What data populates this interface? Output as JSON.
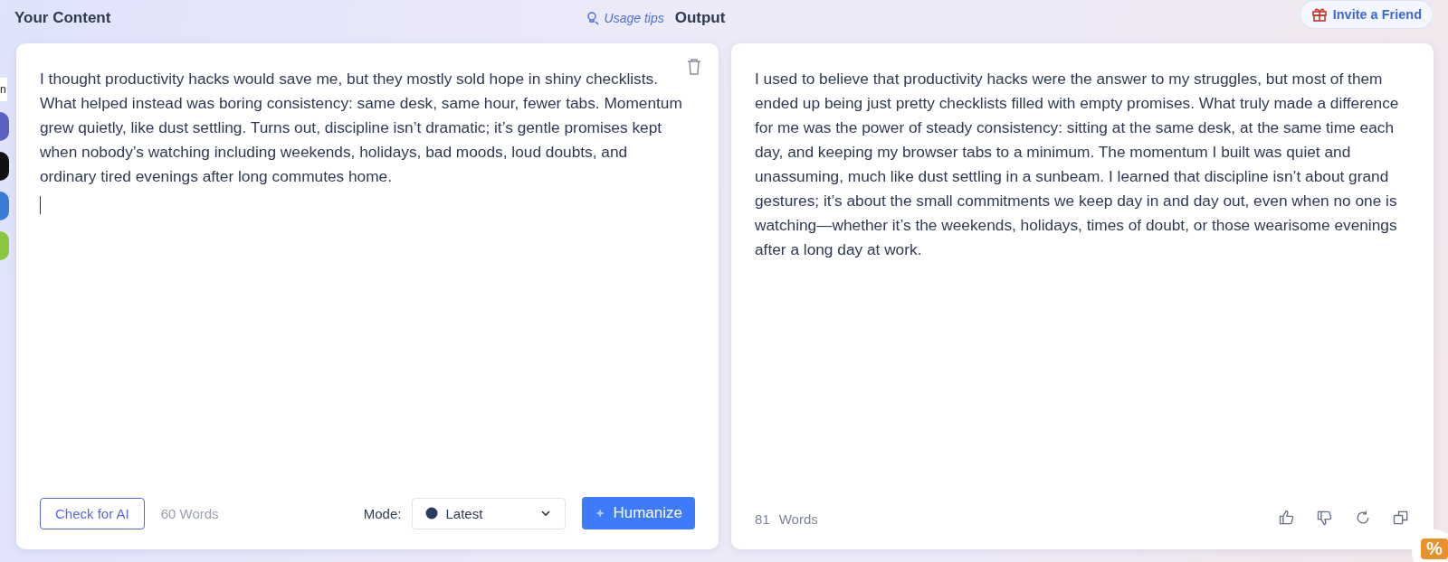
{
  "header": {
    "left_title": "Your Content",
    "usage_tips": "Usage tips",
    "right_title": "Output",
    "invite_button": "Invite a Friend"
  },
  "side_strip": {
    "partial_label": "n"
  },
  "input_panel": {
    "text": "I thought productivity hacks would save me, but they mostly sold hope in shiny checklists. What helped instead was boring consistency: same desk, same hour, fewer tabs. Momentum grew quietly, like dust settling. Turns out, discipline isn’t dramatic; it’s gentle promises kept when nobody’s watching including weekends, holidays, bad moods, loud doubts, and ordinary tired evenings after long commutes home.",
    "check_button": "Check for AI",
    "word_count": "60 Words",
    "mode_label": "Mode:",
    "mode_value": "Latest",
    "humanize_button": "Humanize"
  },
  "output_panel": {
    "text": "I used to believe that productivity hacks were the answer to my struggles, but most of them ended up being just pretty checklists filled with empty promises. What truly made a difference for me was the power of steady consistency: sitting at the same desk, at the same time each day, and keeping my browser tabs to a minimum. The momentum I built was quiet and unassuming, much like dust settling in a sunbeam. I learned that discipline isn’t about grand gestures; it’s about the small commitments we keep day in and day out, even when no one is watching—whether it’s the weekends, holidays, times of doubt, or those wearisome evenings after a long day at work.",
    "word_number": "81",
    "word_unit": "Words"
  },
  "promo_badge": {
    "symbol": "%"
  }
}
